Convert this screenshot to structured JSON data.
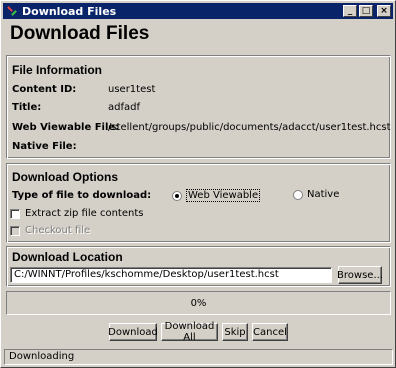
{
  "window": {
    "title": "Download Files",
    "minimize_glyph": "_",
    "maximize_glyph": "□",
    "close_glyph": "×"
  },
  "page_title": "Download Files",
  "file_info": {
    "heading": "File Information",
    "content_id_label": "Content ID:",
    "content_id_value": "user1test",
    "title_label": "Title:",
    "title_value": "adfadf",
    "web_file_label": "Web Viewable File:",
    "web_file_value": "/stellent/groups/public/documents/adacct/user1test.hcst",
    "native_file_label": "Native File:",
    "native_file_value": ""
  },
  "download_options": {
    "heading": "Download Options",
    "type_label": "Type of file to download:",
    "radio_web": "Web Viewable",
    "radio_native": "Native",
    "selected": "web",
    "extract_zip": "Extract zip file contents",
    "checkout": "Checkout file"
  },
  "download_location": {
    "heading": "Download Location",
    "path": "C:/WINNT/Profiles/kschomme/Desktop/user1test.hcst",
    "browse_label": "Browse..."
  },
  "progress": {
    "percent_text": "0%",
    "value": 0
  },
  "actions": {
    "download": "Download",
    "download_all": "Download All",
    "skip": "Skip",
    "cancel": "Cancel"
  },
  "status_text": "Downloading"
}
